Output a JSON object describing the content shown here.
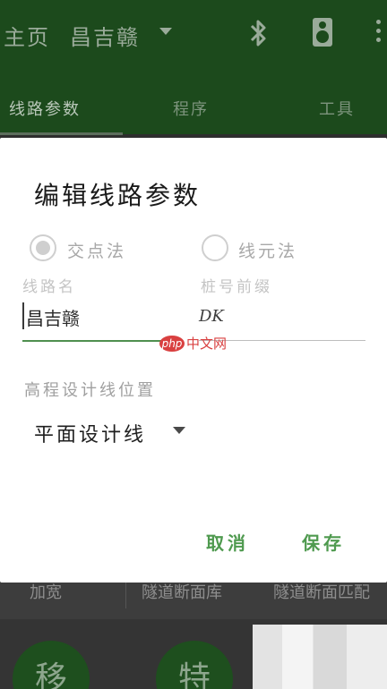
{
  "appbar": {
    "home_label": "主页",
    "route_name": "昌吉赣",
    "icons": [
      "bluetooth-icon",
      "speaker-icon",
      "overflow-menu-icon"
    ],
    "background_color": "#1c4a1c"
  },
  "tabs": [
    {
      "label": "线路参数",
      "active": true
    },
    {
      "label": "程序",
      "active": false
    },
    {
      "label": "工具",
      "active": false
    }
  ],
  "dialog": {
    "title": "编辑线路参数",
    "radios": [
      {
        "label": "交点法",
        "checked": true
      },
      {
        "label": "线元法",
        "checked": false
      }
    ],
    "route_name_label": "线路名",
    "route_name_value": "昌吉赣",
    "prefix_label": "桩号前缀",
    "prefix_value": "DK",
    "elevation_label": "高程设计线位置",
    "elevation_selected": "平面设计线",
    "cancel_label": "取消",
    "save_label": "保存",
    "accent_color": "#4f9a4f"
  },
  "background_list": {
    "items": [
      "加宽",
      "隧道断面库",
      "隧道断面匹配"
    ]
  },
  "fabs": [
    "移",
    "特"
  ],
  "watermark": {
    "badge": "php",
    "text": "中文网"
  }
}
